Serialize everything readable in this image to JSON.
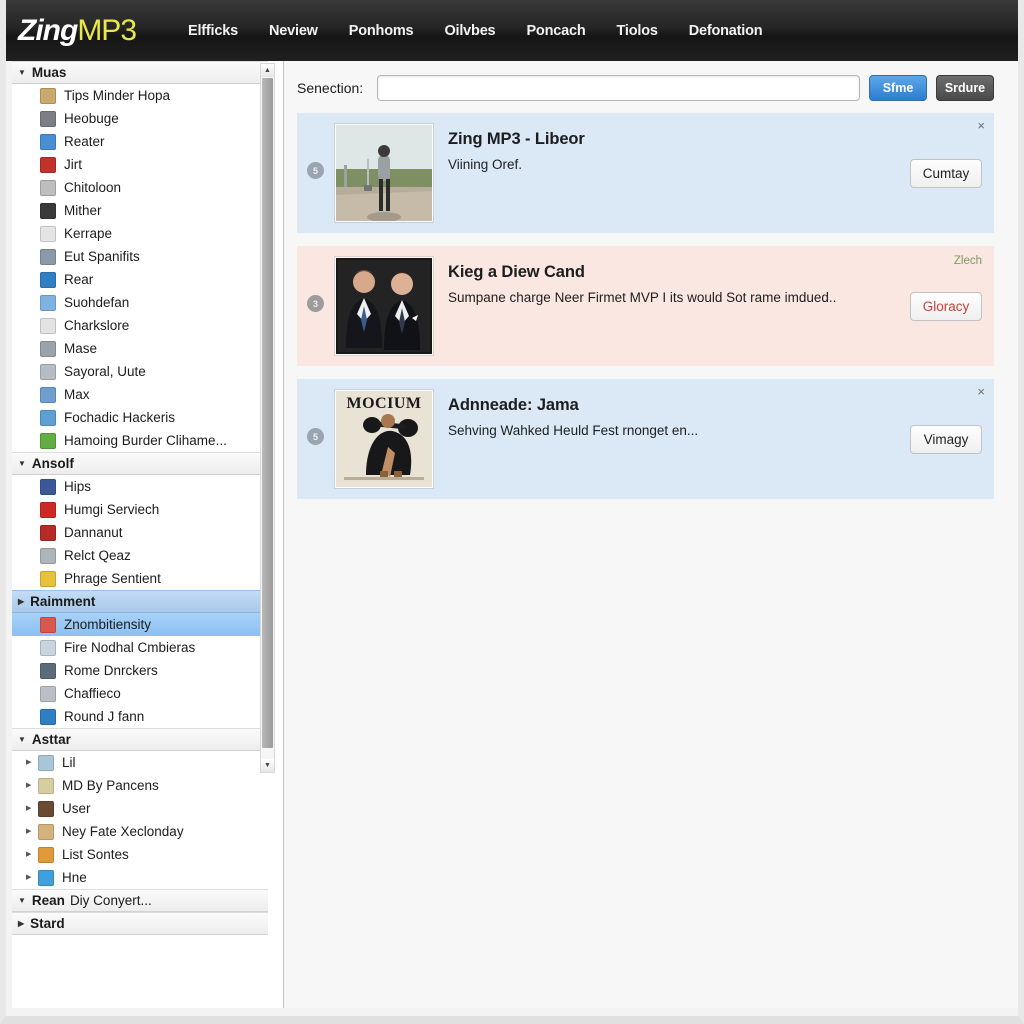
{
  "header": {
    "logo_primary": "Zing",
    "logo_secondary": "MP3",
    "nav": [
      {
        "label": "Elfficks"
      },
      {
        "label": "Neview"
      },
      {
        "label": "Ponhoms"
      },
      {
        "label": "Oilvbes"
      },
      {
        "label": "Poncach"
      },
      {
        "label": "Tiolos"
      },
      {
        "label": "Defonation"
      }
    ]
  },
  "search": {
    "label": "Senection:",
    "value": "",
    "placeholder": "",
    "primary_button": "Sfme",
    "secondary_button": "Srdure"
  },
  "sidebar": {
    "groups": [
      {
        "title": "Muas",
        "title_sub": "",
        "expanded": true,
        "selected": false,
        "tree": false,
        "items": [
          {
            "label": "Tips Minder Hopa",
            "icon": "folder-icon",
            "color": "#c9a86b"
          },
          {
            "label": "Heobuge",
            "icon": "globe-icon",
            "color": "#7b7f85"
          },
          {
            "label": "Reater",
            "icon": "window-icon",
            "color": "#4a8fd4"
          },
          {
            "label": "Jirt",
            "icon": "pill-icon",
            "color": "#c0332c"
          },
          {
            "label": "Chitoloon",
            "icon": "printer-icon",
            "color": "#bdbdbd"
          },
          {
            "label": "Mither",
            "icon": "bird-icon",
            "color": "#3a3a3a"
          },
          {
            "label": "Kerrape",
            "icon": "clock-icon",
            "color": "#e4e4e4"
          },
          {
            "label": "Eut Spanifits",
            "icon": "panel-icon",
            "color": "#8a9aa8"
          },
          {
            "label": "Rear",
            "icon": "arrow-right-icon",
            "color": "#2f7fc4"
          },
          {
            "label": "Suohdefan",
            "icon": "photo-icon",
            "color": "#7fb2de"
          },
          {
            "label": "Charkslore",
            "icon": "runner-icon",
            "color": "#e3e3e3"
          },
          {
            "label": "Mase",
            "icon": "drawer-icon",
            "color": "#9aa3ab"
          },
          {
            "label": "Sayoral, Uute",
            "icon": "book-icon",
            "color": "#b5bcc3"
          },
          {
            "label": "Max",
            "icon": "smiley-icon",
            "color": "#6f9fcc"
          },
          {
            "label": "Fochadic Hackeris",
            "icon": "browser-icon",
            "color": "#5fa0d4"
          },
          {
            "label": "Hamoing Burder Clihame...",
            "icon": "user-green-icon",
            "color": "#63ae42"
          }
        ]
      },
      {
        "title": "Ansolf",
        "title_sub": "",
        "expanded": true,
        "selected": false,
        "tree": false,
        "items": [
          {
            "label": "Hips",
            "icon": "facebook-icon",
            "color": "#3b5998"
          },
          {
            "label": "Humgi Serviech",
            "icon": "red-star-icon",
            "color": "#cc2a24"
          },
          {
            "label": "Dannanut",
            "icon": "red-doc-icon",
            "color": "#b52b25"
          },
          {
            "label": "Relct Qeaz",
            "icon": "spray-icon",
            "color": "#adb4ba"
          },
          {
            "label": "Phrage Sentient",
            "icon": "warning-icon",
            "color": "#e8c13c"
          }
        ]
      },
      {
        "title": "Raimment",
        "title_sub": "",
        "expanded": false,
        "selected": true,
        "tree": false,
        "items": [
          {
            "label": "Znombitiensity",
            "icon": "gift-icon",
            "color": "#d9574f",
            "selected": true
          },
          {
            "label": "Fire Nodhal Cmbieras",
            "icon": "card-icon",
            "color": "#c8d4de",
            "selected": false
          },
          {
            "label": "Rome Dnrckers",
            "icon": "ship-icon",
            "color": "#5b6b7a",
            "selected": false
          },
          {
            "label": "Chaffieco",
            "icon": "keyboard-icon",
            "color": "#b9bfc5",
            "selected": false
          },
          {
            "label": "Round J fann",
            "icon": "disc-icon",
            "color": "#2d7ec4",
            "selected": false
          }
        ]
      },
      {
        "title": "Asttar",
        "title_sub": "",
        "expanded": true,
        "selected": false,
        "tree": true,
        "items": [
          {
            "label": "Lil",
            "icon": "map-icon",
            "color": "#a9c6d9"
          },
          {
            "label": "MD By Pancens",
            "icon": "calendar-icon",
            "color": "#d8cda0"
          },
          {
            "label": "User",
            "icon": "avatar-icon",
            "color": "#6b4a32"
          },
          {
            "label": "Ney Fate Xeclonday",
            "icon": "bottle-icon",
            "color": "#d4b27e"
          },
          {
            "label": "List Sontes",
            "icon": "export-icon",
            "color": "#e09a3a"
          },
          {
            "label": "Hne",
            "icon": "share-icon",
            "color": "#3fa0dd"
          }
        ]
      },
      {
        "title": "Rean",
        "title_sub": "Diy Conyert...",
        "expanded": true,
        "selected": false,
        "tree": false,
        "items": []
      },
      {
        "title": "Stard",
        "title_sub": "",
        "expanded": false,
        "selected": false,
        "tree": false,
        "items": []
      }
    ]
  },
  "main": {
    "cards": [
      {
        "badge": "5",
        "title": "Zing MP3 - Libeor",
        "desc": "Viining Oref.",
        "action": "Cumtay",
        "theme": "blue",
        "close": "×",
        "note": "",
        "thumb": "woman-walking-photo"
      },
      {
        "badge": "3",
        "title": "Kieg a Diew Cand",
        "desc": "Sumpane charge Neer Firmet MVP I its would Sot rame imdued..",
        "action": "Gloracy",
        "theme": "pink",
        "close": "",
        "note": "Zlech",
        "thumb": "two-men-suits-photo"
      },
      {
        "badge": "5",
        "title": "Adnneade: Jama",
        "desc": "Sehving Wahked Heuld Fest rnonget en...",
        "action": "Vimagy",
        "theme": "blue",
        "close": "×",
        "note": "",
        "thumb": "mocium-magazine-cover"
      }
    ]
  },
  "colors": {
    "accent_blue": "#2b7dd1",
    "card_blue": "#dbe8f6",
    "card_pink": "#fae7e1",
    "logo_yellow": "#e8e84a",
    "selection_blue": "#8bc0f2"
  }
}
